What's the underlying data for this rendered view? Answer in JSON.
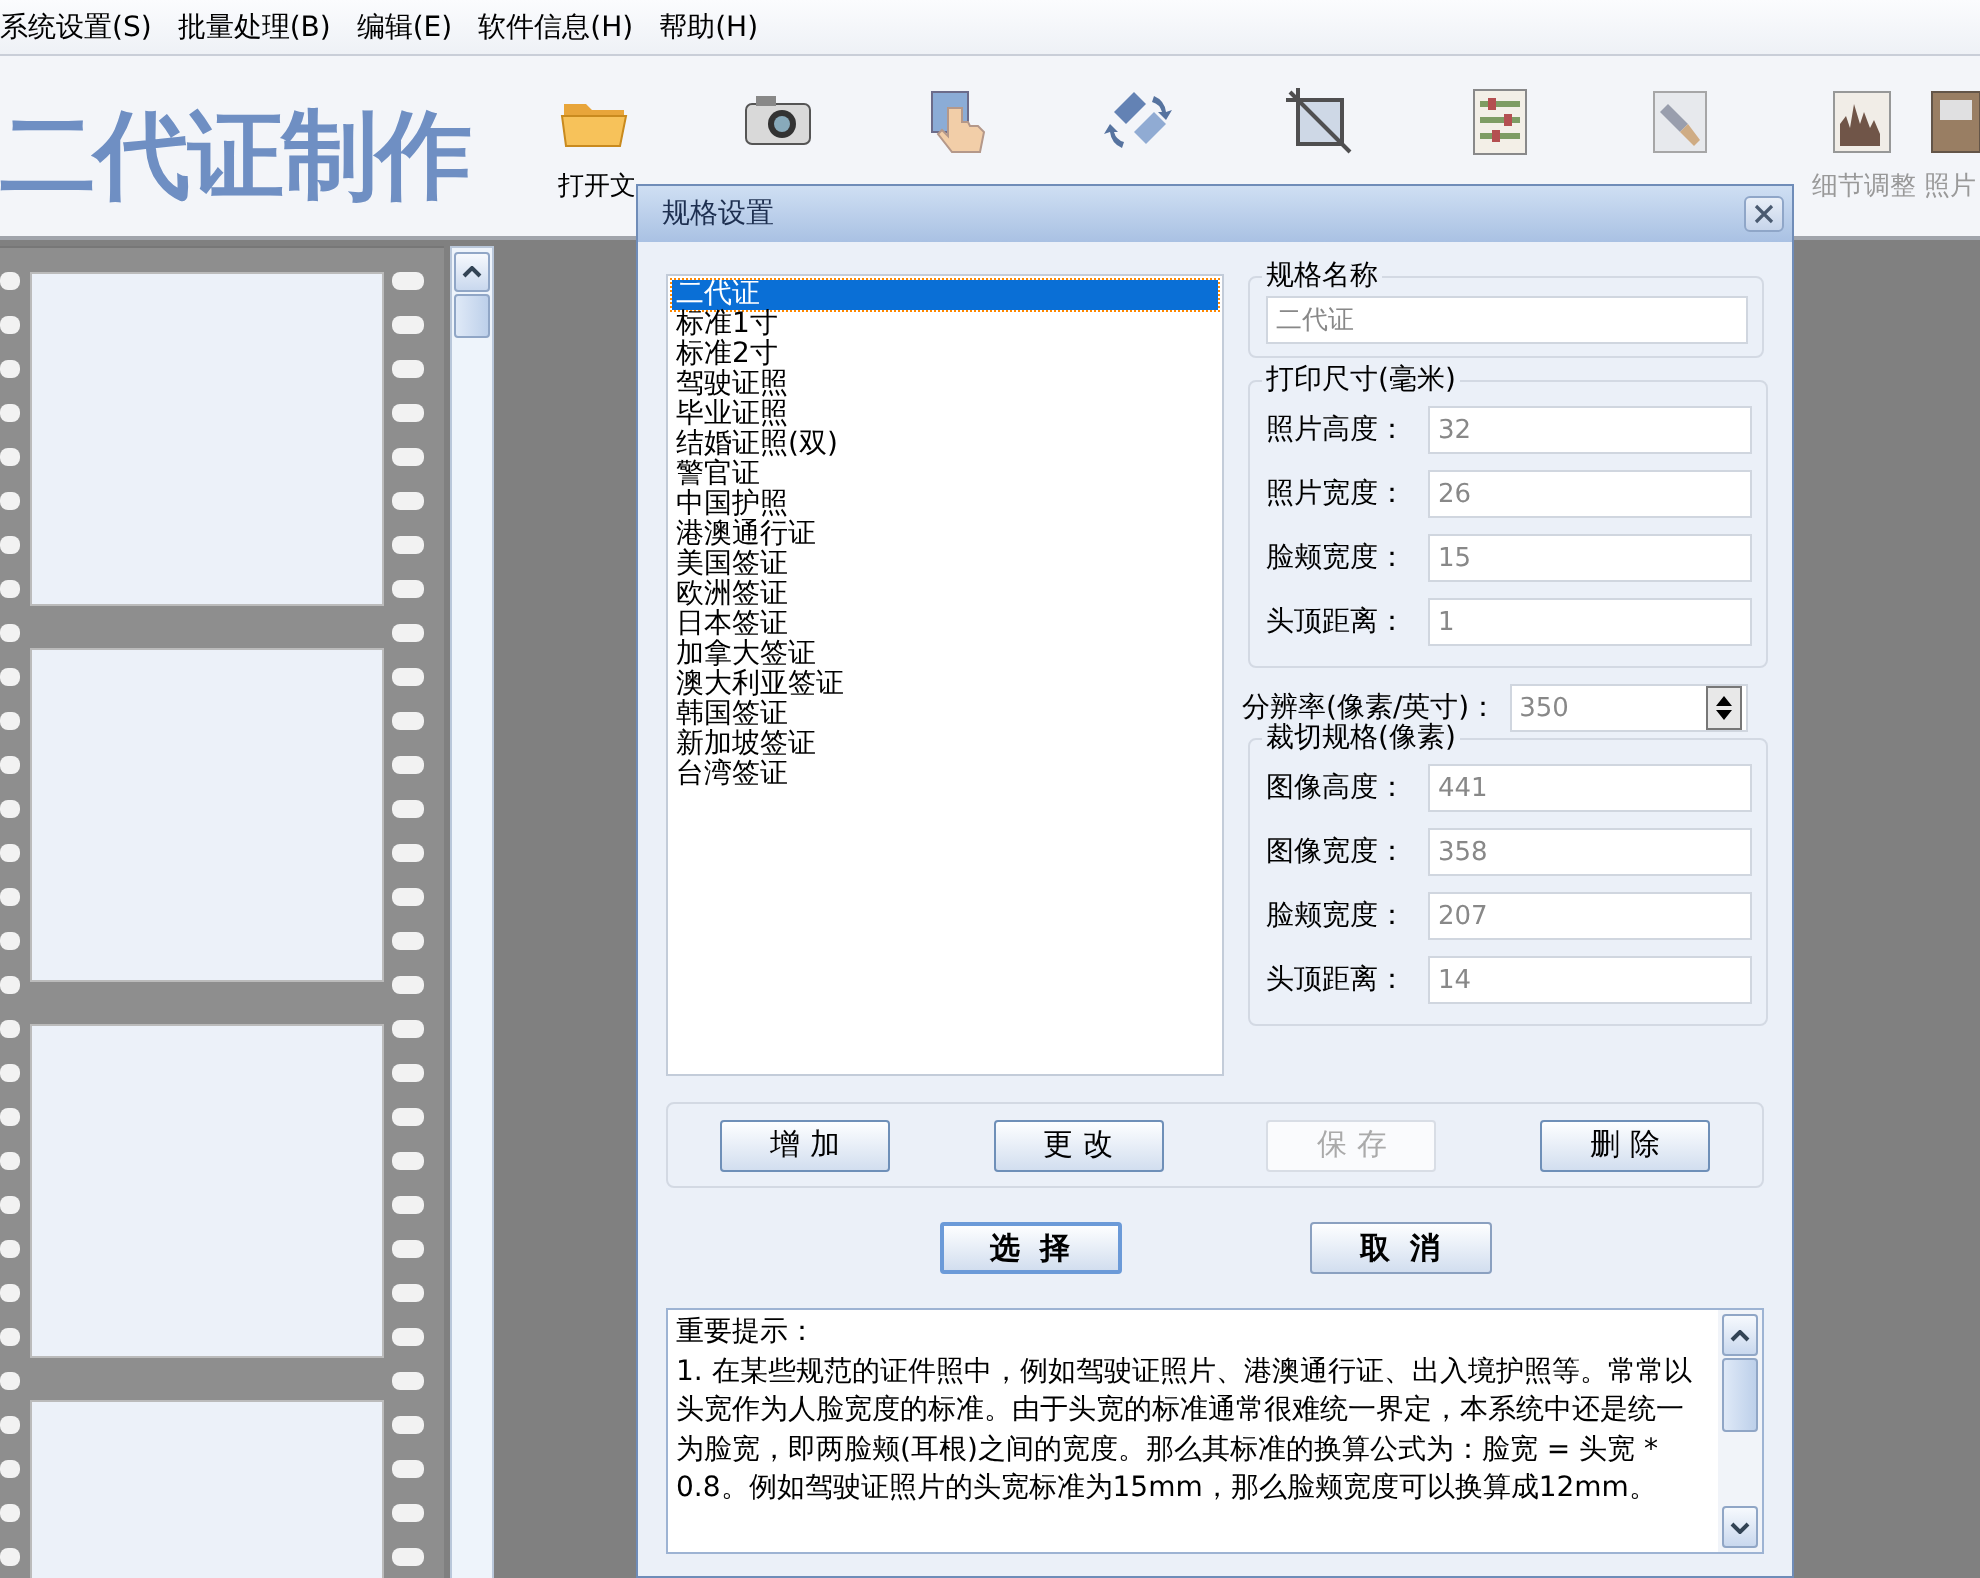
{
  "menu": [
    {
      "label": "系统设置(S)"
    },
    {
      "label": "批量处理(B)"
    },
    {
      "label": "编辑(E)"
    },
    {
      "label": "软件信息(H)"
    },
    {
      "label": "帮助(H)"
    }
  ],
  "toolbar": {
    "logo": "二代证制作",
    "tools": [
      {
        "label": "打开文",
        "disabled": false
      },
      {
        "disabled": false
      },
      {
        "disabled": true
      },
      {
        "disabled": true
      },
      {
        "disabled": true
      },
      {
        "disabled": true
      },
      {
        "disabled": true
      },
      {
        "label": "细节调整",
        "disabled": true
      },
      {
        "label": "照片",
        "disabled": true
      }
    ]
  },
  "dialog": {
    "title": "规格设置",
    "specs": [
      {
        "label": "二代证",
        "selected": true
      },
      {
        "label": "标准1寸",
        "selected": false
      },
      {
        "label": "标准2寸",
        "selected": false
      },
      {
        "label": "驾驶证照",
        "selected": false
      },
      {
        "label": "毕业证照",
        "selected": false
      },
      {
        "label": "结婚证照(双)",
        "selected": false
      },
      {
        "label": "警官证",
        "selected": false
      },
      {
        "label": "中国护照",
        "selected": false
      },
      {
        "label": "港澳通行证",
        "selected": false
      },
      {
        "label": "美国签证",
        "selected": false
      },
      {
        "label": "欧洲签证",
        "selected": false
      },
      {
        "label": "日本签证",
        "selected": false
      },
      {
        "label": "加拿大签证",
        "selected": false
      },
      {
        "label": "澳大利亚签证",
        "selected": false
      },
      {
        "label": "韩国签证",
        "selected": false
      },
      {
        "label": "新加坡签证",
        "selected": false
      },
      {
        "label": "台湾签证",
        "selected": false
      }
    ],
    "name_group": {
      "title": "规格名称",
      "value": "二代证"
    },
    "print_group": {
      "title": "打印尺寸(毫米)",
      "fields": [
        {
          "label": "照片高度：",
          "value": "32"
        },
        {
          "label": "照片宽度：",
          "value": "26"
        },
        {
          "label": "脸颊宽度：",
          "value": "15"
        },
        {
          "label": "头顶距离：",
          "value": "1"
        }
      ]
    },
    "resolution": {
      "label": "分辨率(像素/英寸)：",
      "value": "350"
    },
    "crop_group": {
      "title": "裁切规格(像素)",
      "fields": [
        {
          "label": "图像高度：",
          "value": "441"
        },
        {
          "label": "图像宽度：",
          "value": "358"
        },
        {
          "label": "脸颊宽度：",
          "value": "207"
        },
        {
          "label": "头顶距离：",
          "value": "14"
        }
      ]
    },
    "edit_buttons": [
      {
        "label": "增 加",
        "disabled": false
      },
      {
        "label": "更 改",
        "disabled": false
      },
      {
        "label": "保 存",
        "disabled": true
      },
      {
        "label": "删 除",
        "disabled": false
      }
    ],
    "action_buttons": [
      {
        "label": "选  择",
        "default": true
      },
      {
        "label": "取  消",
        "default": false
      }
    ],
    "notes": {
      "heading": "重要提示：",
      "body": "1. 在某些规范的证件照中，例如驾驶证照片、港澳通行证、出入境护照等。常常以头宽作为人脸宽度的标准。由于头宽的标准通常很难统一界定，本系统中还是统一为脸宽，即两脸颊(耳根)之间的宽度。那么其标准的换算公式为：脸宽 = 头宽 * 0.8。例如驾驶证照片的头宽标准为15mm，那么脸颊宽度可以换算成12mm。"
    }
  }
}
